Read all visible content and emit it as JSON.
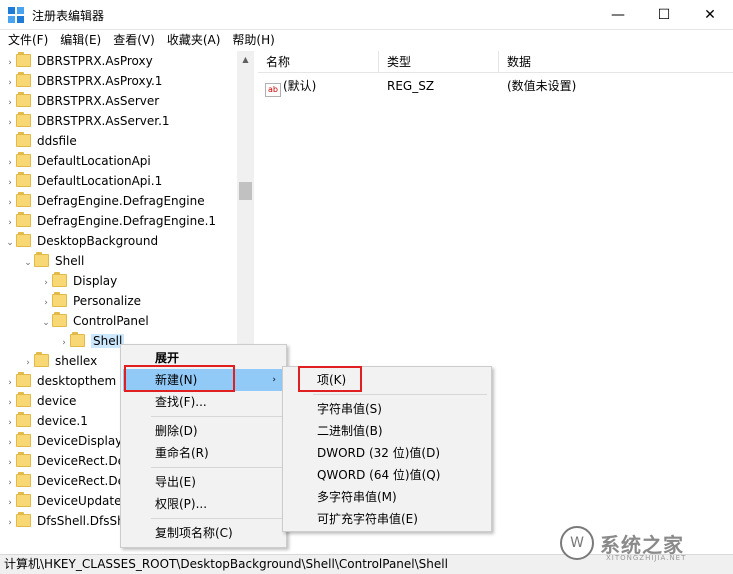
{
  "window": {
    "title": "注册表编辑器",
    "minimize_glyph": "—",
    "maximize_glyph": "☐",
    "close_glyph": "✕"
  },
  "menubar": [
    "文件(F)",
    "编辑(E)",
    "查看(V)",
    "收藏夹(A)",
    "帮助(H)"
  ],
  "tree": [
    {
      "label": "DBRSTPRX.AsProxy",
      "expander": "›"
    },
    {
      "label": "DBRSTPRX.AsProxy.1",
      "expander": "›"
    },
    {
      "label": "DBRSTPRX.AsServer",
      "expander": "›"
    },
    {
      "label": "DBRSTPRX.AsServer.1",
      "expander": "›"
    },
    {
      "label": "ddsfile",
      "expander": ""
    },
    {
      "label": "DefaultLocationApi",
      "expander": "›"
    },
    {
      "label": "DefaultLocationApi.1",
      "expander": "›"
    },
    {
      "label": "DefragEngine.DefragEngine",
      "expander": "›"
    },
    {
      "label": "DefragEngine.DefragEngine.1",
      "expander": "›"
    },
    {
      "label": "DesktopBackground",
      "expander": "⌄"
    },
    {
      "label": "Shell",
      "expander": "⌄"
    },
    {
      "label": "Display",
      "expander": "›"
    },
    {
      "label": "Personalize",
      "expander": "›"
    },
    {
      "label": "ControlPanel",
      "expander": "⌄"
    },
    {
      "label": "Shell",
      "expander": "›"
    },
    {
      "label": "shellex",
      "expander": "›"
    },
    {
      "label": "desktopthem",
      "expander": "›"
    },
    {
      "label": "device",
      "expander": "›"
    },
    {
      "label": "device.1",
      "expander": "›"
    },
    {
      "label": "DeviceDisplay",
      "expander": "›"
    },
    {
      "label": "DeviceRect.De",
      "expander": "›"
    },
    {
      "label": "DeviceRect.De",
      "expander": "›"
    },
    {
      "label": "DeviceUpdate",
      "expander": "›"
    },
    {
      "label": "DfsShell.DfsSh",
      "expander": "›"
    }
  ],
  "list": {
    "headers": [
      "名称",
      "类型",
      "数据"
    ],
    "rows": [
      {
        "icon": "ab",
        "name": "(默认)",
        "type": "REG_SZ",
        "data": "(数值未设置)"
      }
    ]
  },
  "status": "计算机\\HKEY_CLASSES_ROOT\\DesktopBackground\\Shell\\ControlPanel\\Shell",
  "context_menu": {
    "items": [
      "展开",
      "新建(N)",
      "查找(F)...",
      "删除(D)",
      "重命名(R)",
      "导出(E)",
      "权限(P)...",
      "复制项名称(C)"
    ],
    "submenu_arrow": "›"
  },
  "submenu": {
    "items": [
      "项(K)",
      "字符串值(S)",
      "二进制值(B)",
      "DWORD (32 位)值(D)",
      "QWORD (64 位)值(Q)",
      "多字符串值(M)",
      "可扩充字符串值(E)"
    ]
  },
  "watermark": {
    "logo": "W",
    "text": "系统之家",
    "sub": "XITONGZHIJIA.NET"
  },
  "colors": {
    "folder": "#f8d775",
    "highlight": "#91c9f7",
    "redbox": "#e02020",
    "selection": "#cce8ff"
  }
}
